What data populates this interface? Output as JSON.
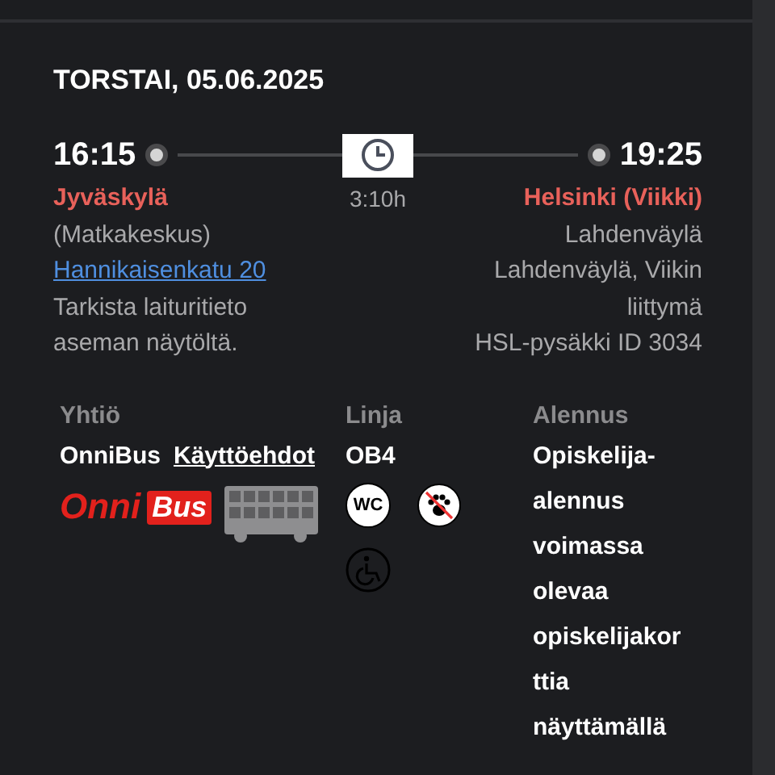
{
  "date": "TORSTAI, 05.06.2025",
  "departure": {
    "time": "16:15",
    "city": "Jyväskylä",
    "lines": [
      {
        "kind": "text",
        "text": "(Matkakeskus)"
      },
      {
        "kind": "link",
        "text": "Hannikaisenkatu 20"
      },
      {
        "kind": "text",
        "text": "Tarkista laituritieto aseman näytöltä."
      }
    ]
  },
  "duration": "3:10h",
  "arrival": {
    "time": "19:25",
    "city": "Helsinki (Viikki)",
    "lines": [
      {
        "kind": "text",
        "text": "Lahdenväylä"
      },
      {
        "kind": "text",
        "text": "Lahdenväylä, Viikin liittymä"
      },
      {
        "kind": "text",
        "text": "HSL-pysäkki ID 3034"
      }
    ]
  },
  "company": {
    "heading": "Yhtiö",
    "name": "OnniBus",
    "terms_link": "Käyttöehdot",
    "logo": [
      "Onni",
      "Bus"
    ]
  },
  "line": {
    "heading": "Linja",
    "code": "OB4",
    "amenities": [
      {
        "kind": "wc",
        "text": "WC"
      },
      {
        "kind": "no-pets"
      },
      {
        "kind": "wheelchair"
      }
    ]
  },
  "discount": {
    "heading": "Alennus",
    "text": "Opiskelija-alennus voimassa olevaa opiskelijakorttia näyttämällä"
  }
}
